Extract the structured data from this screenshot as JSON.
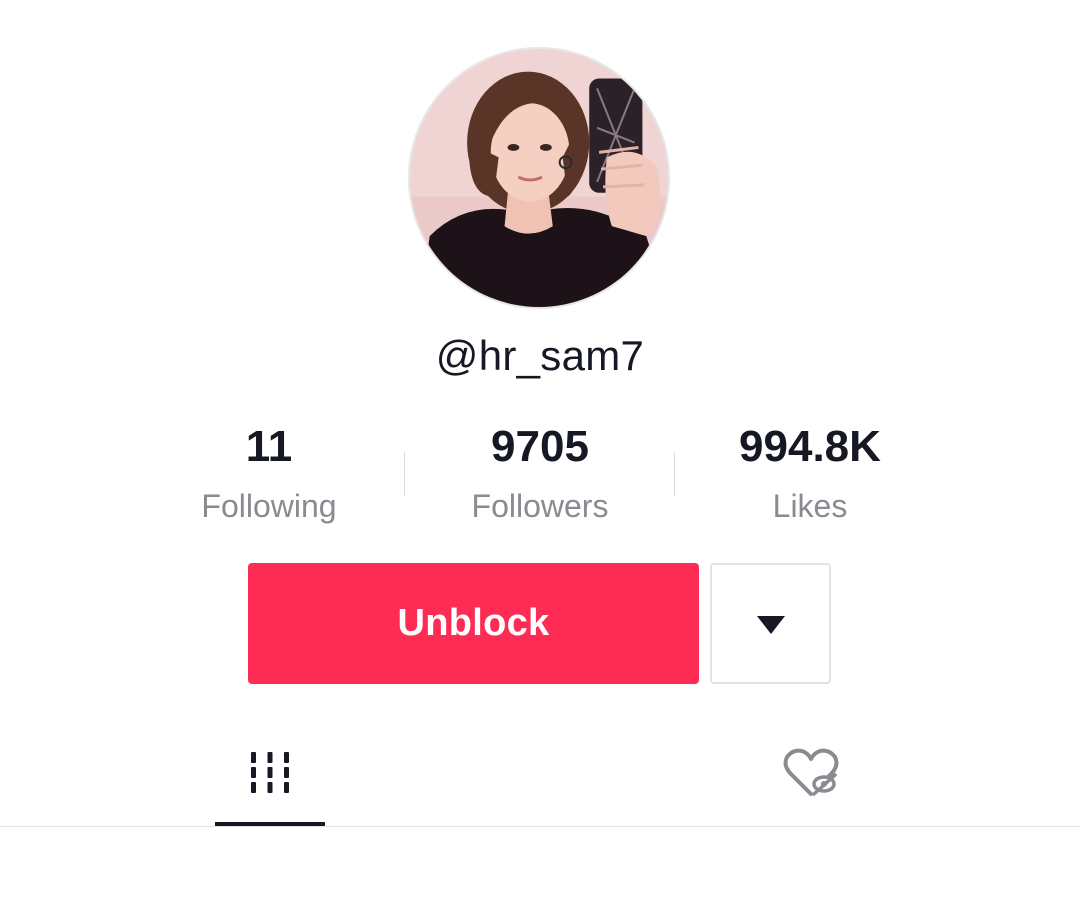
{
  "profile": {
    "username": "@hr_sam7",
    "avatar_icon": "profile-photo"
  },
  "stats": {
    "following": {
      "value": "11",
      "label": "Following"
    },
    "followers": {
      "value": "9705",
      "label": "Followers"
    },
    "likes": {
      "value": "994.8K",
      "label": "Likes"
    }
  },
  "actions": {
    "unblock_label": "Unblock",
    "dropdown_icon": "caret-down-icon"
  },
  "tabs": [
    {
      "name": "videos",
      "icon": "grid-icon",
      "active": true
    },
    {
      "name": "liked",
      "icon": "heart-hidden-icon",
      "active": false
    }
  ],
  "colors": {
    "accent": "#fe2c55",
    "text_primary": "#161823",
    "text_secondary": "#8a8b91",
    "border": "#e3e3e4"
  }
}
